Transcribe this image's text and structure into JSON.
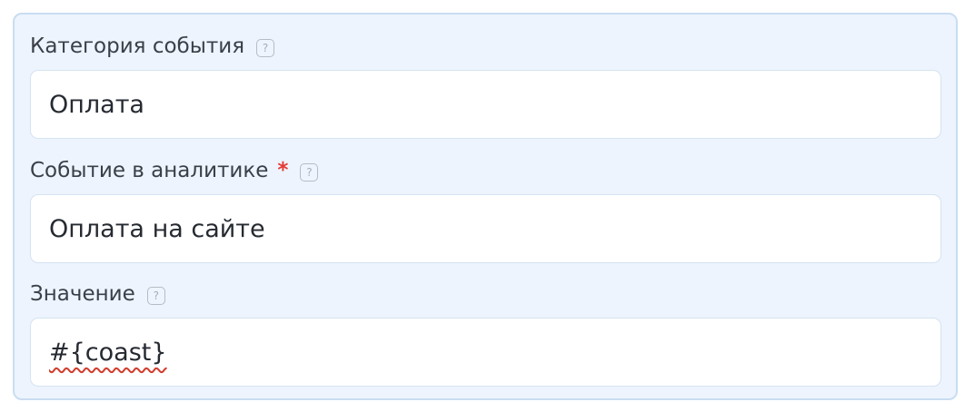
{
  "form": {
    "fields": [
      {
        "label": "Категория события",
        "required": false,
        "help_icon": "question-mark-icon",
        "help_glyph": "?",
        "value": "Оплата"
      },
      {
        "label": "Событие в аналитике",
        "required": true,
        "required_mark": "*",
        "help_icon": "question-mark-icon",
        "help_glyph": "?",
        "value": "Оплата на сайте"
      },
      {
        "label": "Значение",
        "required": false,
        "help_icon": "question-mark-icon",
        "help_glyph": "?",
        "value": "#{coast}",
        "spellcheck_error": true
      }
    ]
  },
  "colors": {
    "panel_background": "#edf4fd",
    "panel_border": "#c9ddf2",
    "input_background": "#ffffff",
    "required_mark": "#e53935",
    "spellcheck_underline": "#d23c2c"
  }
}
